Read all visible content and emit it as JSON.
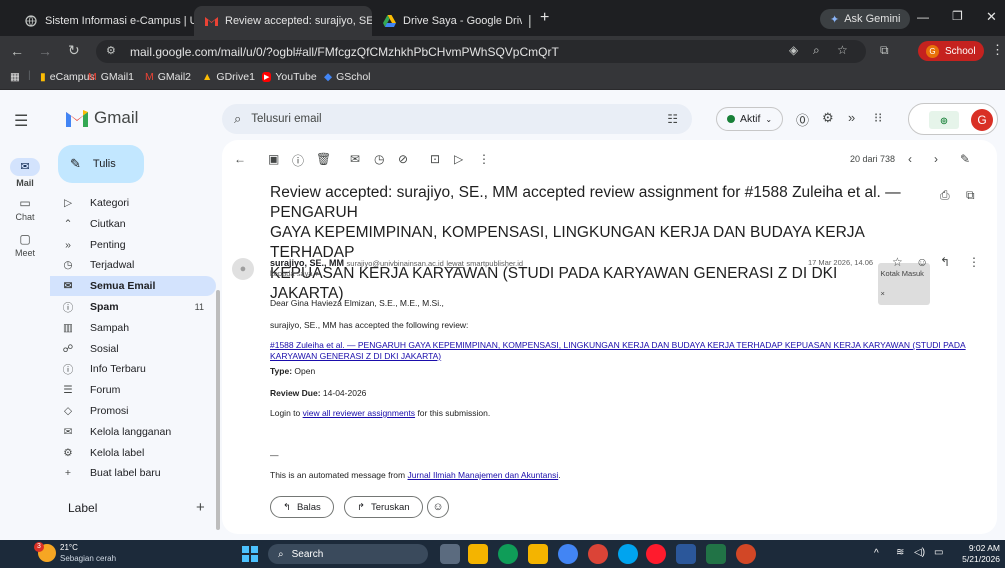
{
  "browser": {
    "tabs": [
      {
        "label": "Sistem Informasi e-Campus | U",
        "active": false
      },
      {
        "label": "Review accepted: surajiyo, SE, I",
        "active": true
      },
      {
        "label": "Drive Saya - Google Drive",
        "active": false
      }
    ],
    "ask_gemini": "Ask Gemini",
    "url": "mail.google.com/mail/u/0/?ogbl#all/FMfcgzQfCMzhkhPbCHvmPWhSQVpCmQrT",
    "profile_label": "School",
    "bookmarks": [
      "eCampus",
      "GMail1",
      "GMail2",
      "GDrive1",
      "YouTube",
      "GSchol"
    ]
  },
  "gmail": {
    "logo_text": "Gmail",
    "search_placeholder": "Telusuri email",
    "status_label": "Aktif",
    "avatar_letter": "G",
    "rail": [
      {
        "label": "Mail"
      },
      {
        "label": "Chat"
      },
      {
        "label": "Meet"
      }
    ],
    "compose_label": "Tulis",
    "nav": [
      {
        "label": "Kategori",
        "icon": "label-icon"
      },
      {
        "label": "Ciutkan",
        "icon": "chevron-up-icon"
      },
      {
        "label": "Penting",
        "icon": "important-icon"
      },
      {
        "label": "Terjadwal",
        "icon": "scheduled-icon"
      },
      {
        "label": "Semua Email",
        "icon": "all-mail-icon",
        "selected": true
      },
      {
        "label": "Spam",
        "icon": "spam-icon",
        "count": "11",
        "bold": true
      },
      {
        "label": "Sampah",
        "icon": "trash-icon"
      },
      {
        "label": "Sosial",
        "icon": "social-icon"
      },
      {
        "label": "Info Terbaru",
        "icon": "info-icon"
      },
      {
        "label": "Forum",
        "icon": "forum-icon"
      },
      {
        "label": "Promosi",
        "icon": "promo-icon"
      },
      {
        "label": "Kelola langganan",
        "icon": "subscriptions-icon"
      },
      {
        "label": "Kelola label",
        "icon": "gear-icon"
      },
      {
        "label": "Buat label baru",
        "icon": "plus-icon"
      }
    ],
    "labels_heading": "Label",
    "pagination": "20 dari 738",
    "subject": "Review accepted: surajiyo, SE., MM accepted review assignment for #1588 Zuleiha et al. — PENGARUH GAYA KEPEMIMPINAN, KOMPENSASI, LINGKUNGAN KERJA DAN BUDAYA KERJA TERHADAP KEPUASAN KERJA KARYAWAN (STUDI PADA KARYAWAN GENERASI Z DI DKI JAKARTA)",
    "subject_lines": [
      "Review accepted: surajiyo, SE., MM accepted review assignment for #1588 Zuleiha et al. — PENGARUH",
      "GAYA KEPEMIMPINAN, KOMPENSASI, LINGKUNGAN KERJA DAN BUDAYA KERJA TERHADAP",
      "KEPUASAN KERJA KARYAWAN (STUDI PADA KARYAWAN GENERASI Z DI DKI JAKARTA)"
    ],
    "inbox_chip": "Kotak Masuk ×",
    "sender": {
      "name": "surajiyo, SE., MM",
      "email": "surajiyo@univbinainsan.ac.id",
      "via": "lewat",
      "via_domain": "smartpublisher.id",
      "to": "kepada saya"
    },
    "date": "17 Mar 2026, 14.06",
    "body": {
      "greeting": "Dear Gina Havieza Elmizan, S.E., M.E., M.Si.,",
      "line1": "surajiyo, SE., MM has accepted the following review:",
      "link_line1": "#1588 Zuleiha et al. — PENGARUH GAYA KEPEMIMPINAN, KOMPENSASI, LINGKUNGAN KERJA DAN BUDAYA KERJA TERHADAP KEPUASAN KERJA KARYAWAN (STUDI PADA",
      "link_line2": "KARYAWAN GENERASI Z DI DKI JAKARTA)",
      "type_label": "Type:",
      "type_value": "Open",
      "due_label": "Review Due:",
      "due_value": "14-04-2026",
      "login_prefix": "Login to",
      "login_link": "view all reviewer assignments",
      "login_suffix": "for this submission.",
      "dash": "—",
      "auto_prefix": "This is an automated message from",
      "auto_link": "Jurnal Ilmiah Manajemen dan Akuntansi",
      "auto_suffix": "."
    },
    "reply_label": "Balas",
    "forward_label": "Teruskan"
  },
  "taskbar": {
    "weather_temp": "21°C",
    "weather_desc": "Sebagian cerah",
    "weather_badge": "3",
    "search_label": "Search",
    "time": "9:02 AM",
    "date": "5/21/2026"
  },
  "colors": {
    "titlebar": "#1e1f22",
    "tab_active": "#353639",
    "selected_nav": "#d3e3fd",
    "link": "#1a0dab",
    "gmail_red": "#ea4335",
    "status_green": "#188038",
    "taskbar": "#1c2a3a"
  }
}
